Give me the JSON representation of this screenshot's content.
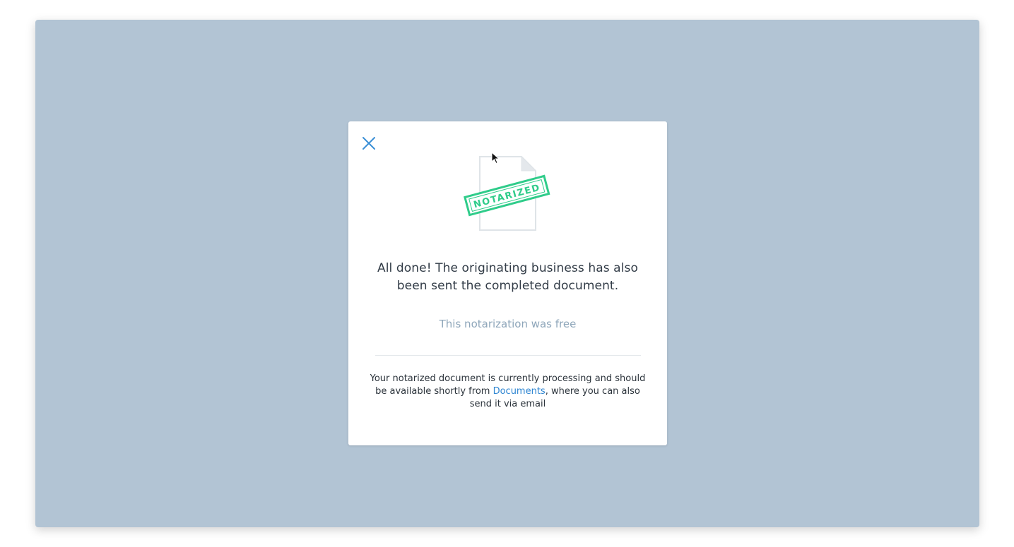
{
  "modal": {
    "stamp_text": "NOTARIZED",
    "main_message": "All done! The originating business has also been sent the completed document.",
    "price_note": "This notarization was free",
    "processing_before": "Your notarized document is currently processing and should be available shortly from ",
    "documents_link": "Documents",
    "processing_after": ", where you can also send it via email"
  },
  "icons": {
    "close": "close-icon",
    "document": "notarized-document-icon",
    "cursor": "mouse-cursor-icon"
  },
  "colors": {
    "backdrop": "#b2c4d4",
    "accent": "#2f86d2",
    "stamp": "#2fcc8a",
    "muted_text": "#8ea6ba"
  }
}
